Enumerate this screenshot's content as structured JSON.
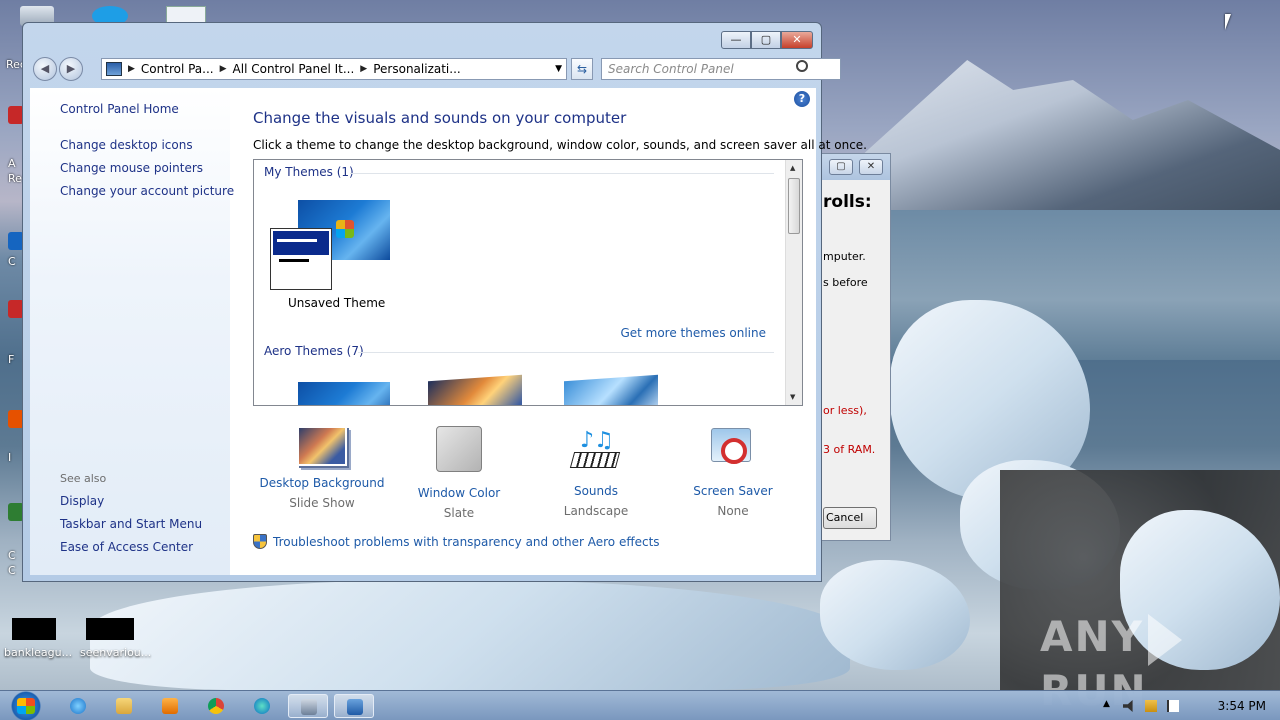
{
  "window": {
    "controls": {
      "minimize": "—",
      "maximize": "▢",
      "close": "✕"
    }
  },
  "address_bar": {
    "crumbs": [
      "Control Pa...",
      "All Control Panel It...",
      "Personalizati..."
    ],
    "search_placeholder": "Search Control Panel"
  },
  "sidebar": {
    "home": "Control Panel Home",
    "links": [
      "Change desktop icons",
      "Change mouse pointers",
      "Change your account picture"
    ],
    "see_also_title": "See also",
    "see_also": [
      "Display",
      "Taskbar and Start Menu",
      "Ease of Access Center"
    ]
  },
  "content": {
    "heading": "Change the visuals and sounds on your computer",
    "subtext": "Click a theme to change the desktop background, window color, sounds, and screen saver all at once.",
    "my_themes_group": "My Themes (1)",
    "my_theme_name": "Unsaved Theme",
    "more_themes_link": "Get more themes online",
    "aero_themes_group": "Aero Themes (7)",
    "tiles": [
      {
        "label": "Desktop Background",
        "value": "Slide Show",
        "icon": "desktop-background-icon"
      },
      {
        "label": "Window Color",
        "value": "Slate",
        "icon": "window-color-icon"
      },
      {
        "label": "Sounds",
        "value": "Landscape",
        "icon": "sounds-icon"
      },
      {
        "label": "Screen Saver",
        "value": "None",
        "icon": "screen-saver-icon"
      }
    ],
    "troubleshoot_link": "Troubleshoot problems with transparency and other Aero effects"
  },
  "background_dialog": {
    "fragments": [
      "rolls:",
      "mputer.",
      "s before",
      "or less),",
      "3 of RAM."
    ],
    "cancel": "Cancel"
  },
  "desktop": {
    "labels": [
      "bankleagu...",
      "seenvariou..."
    ],
    "fragments": [
      "Rec",
      "A",
      "Re",
      "C",
      "F",
      "I",
      "C",
      "C"
    ],
    "watermark": "ANY",
    "watermark2": "RUN"
  },
  "taskbar": {
    "clock": "3:54 PM"
  },
  "colors": {
    "link": "#1e3287",
    "accent_link": "#1e5aa8",
    "warning_text": "#c00000"
  }
}
